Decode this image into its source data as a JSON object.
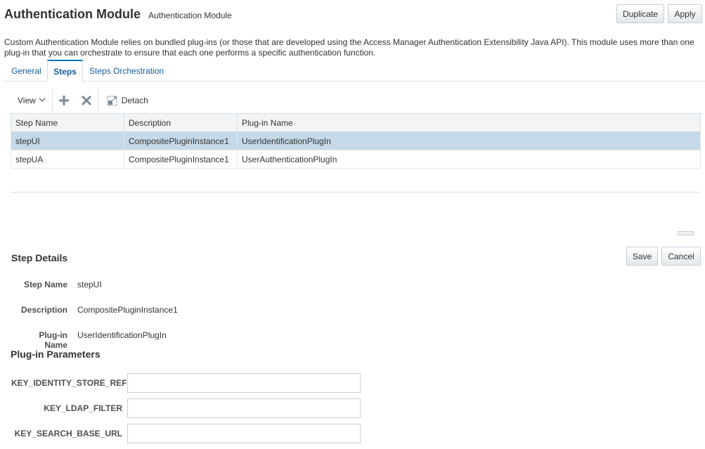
{
  "header": {
    "title": "Authentication Module",
    "subtitle": "Authentication Module"
  },
  "actions": {
    "duplicate_label": "Duplicate",
    "apply_label": "Apply"
  },
  "description": "Custom Authentication Module relies on bundled plug-ins (or those that are developed using the Access Manager Authentication Extensibility Java API). This module uses more than one plug-in that you can orchestrate to ensure that each one performs a specific authentication function.",
  "tabs": [
    {
      "label": "General",
      "active": false
    },
    {
      "label": "Steps",
      "active": true
    },
    {
      "label": "Steps Orchestration",
      "active": false
    }
  ],
  "toolbar": {
    "view_label": "View",
    "add_icon": "plus-icon",
    "delete_icon": "close-icon",
    "detach_label": "Detach"
  },
  "table": {
    "columns": [
      "Step Name",
      "Description",
      "Plug-in Name"
    ],
    "rows": [
      {
        "name": "stepUI",
        "description": "CompositePluginInstance1",
        "plugin": "UserIdentificationPlugIn",
        "selected": true
      },
      {
        "name": "stepUA",
        "description": "CompositePluginInstance1",
        "plugin": "UserAuthenticationPlugIn",
        "selected": false
      }
    ]
  },
  "step_details": {
    "title": "Step Details",
    "save_label": "Save",
    "cancel_label": "Cancel",
    "fields": [
      {
        "label": "Step Name",
        "value": "stepUI"
      },
      {
        "label": "Description",
        "value": "CompositePluginInstance1"
      },
      {
        "label": "Plug-in Name",
        "value": "UserIdentificationPlugIn"
      }
    ]
  },
  "plugin_parameters": {
    "title": "Plug-in Parameters",
    "params": [
      {
        "label": "KEY_IDENTITY_STORE_REF",
        "value": ""
      },
      {
        "label": "KEY_LDAP_FILTER",
        "value": ""
      },
      {
        "label": "KEY_SEARCH_BASE_URL",
        "value": ""
      }
    ]
  },
  "colors": {
    "link": "#145c9e",
    "tab_active_border": "#0572ce",
    "selected_row": "#c5d9e8",
    "border": "#d6dfe6"
  }
}
